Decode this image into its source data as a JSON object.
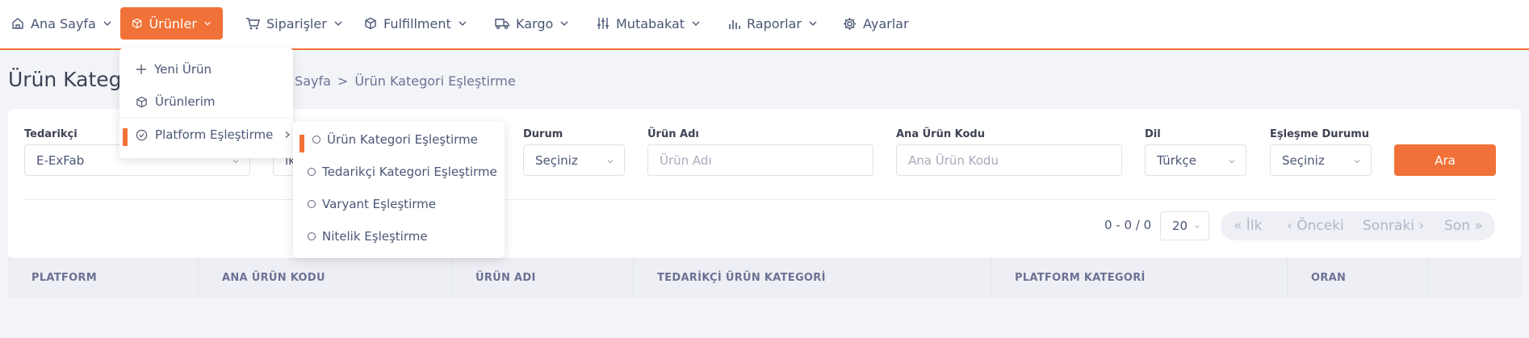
{
  "nav": [
    {
      "label": "Ana Sayfa",
      "icon": "home-icon"
    },
    {
      "label": "Ürünler",
      "icon": "box-icon",
      "active": true
    },
    {
      "label": "Siparişler",
      "icon": "cart-icon"
    },
    {
      "label": "Fulfillment",
      "icon": "cube-icon"
    },
    {
      "label": "Kargo",
      "icon": "truck-icon"
    },
    {
      "label": "Mutabakat",
      "icon": "sliders-icon"
    },
    {
      "label": "Raporlar",
      "icon": "bar-chart-icon"
    },
    {
      "label": "Ayarlar",
      "icon": "gear-icon"
    }
  ],
  "accent_color": "#f07238",
  "page_title": "Ürün Kateg",
  "breadcrumb": {
    "home": "na Sayfa",
    "separator": ">",
    "current": "Ürün Kategori Eşleştirme"
  },
  "products_menu": [
    {
      "label": "Yeni Ürün",
      "icon": "plus-icon"
    },
    {
      "label": "Ürünlerim",
      "icon": "box-icon"
    },
    {
      "label": "Platform Eşleştirme",
      "icon": "check-circle-icon",
      "active": true
    }
  ],
  "platform_submenu": [
    {
      "label": "Ürün Kategori Eşleştirme",
      "active": true
    },
    {
      "label": "Tedarikçi Kategori Eşleştirme"
    },
    {
      "label": "Varyant Eşleştirme"
    },
    {
      "label": "Nitelik Eşleştirme"
    }
  ],
  "filters": {
    "supplier": {
      "label": "Tedarikçi",
      "value": "E-ExFab"
    },
    "second_partial": "ik",
    "status": {
      "label": "Durum",
      "value": "Seçiniz"
    },
    "product_name": {
      "label": "Ürün Adı",
      "placeholder": "Ürün Adı"
    },
    "main_code": {
      "label": "Ana Ürün Kodu",
      "placeholder": "Ana Ürün Kodu"
    },
    "language": {
      "label": "Dil",
      "value": "Türkçe"
    },
    "match_status": {
      "label": "Eşleşme Durumu",
      "value": "Seçiniz"
    },
    "search_button": "Ara"
  },
  "pager": {
    "info": "0 - 0 / 0",
    "page_size": "20",
    "first": "« İlk",
    "prev": "‹ Önceki",
    "next": "Sonraki ›",
    "last": "Son »"
  },
  "table": {
    "columns": [
      "PLATFORM",
      "ANA ÜRÜN KODU",
      "ÜRÜN ADI",
      "TEDARİKÇİ ÜRÜN KATEGORİ",
      "PLATFORM KATEGORİ",
      "ORAN"
    ]
  }
}
